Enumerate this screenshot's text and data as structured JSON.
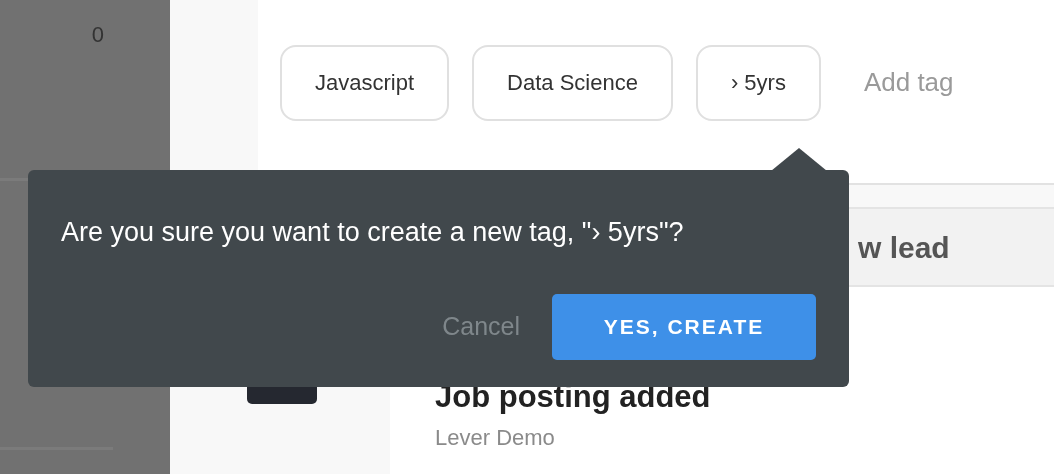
{
  "sidebar": {
    "count": "0"
  },
  "tags": [
    {
      "label": "Javascript"
    },
    {
      "label": "Data Science"
    },
    {
      "label": "› 5yrs"
    }
  ],
  "add_tag": "Add tag",
  "section_header": "w lead",
  "activity": {
    "title": "Job posting added",
    "subtitle": "Lever Demo"
  },
  "confirm_popover": {
    "message": "Are you sure you want to create a new tag, \"› 5yrs\"?",
    "cancel": "Cancel",
    "confirm": "YES, CREATE"
  }
}
